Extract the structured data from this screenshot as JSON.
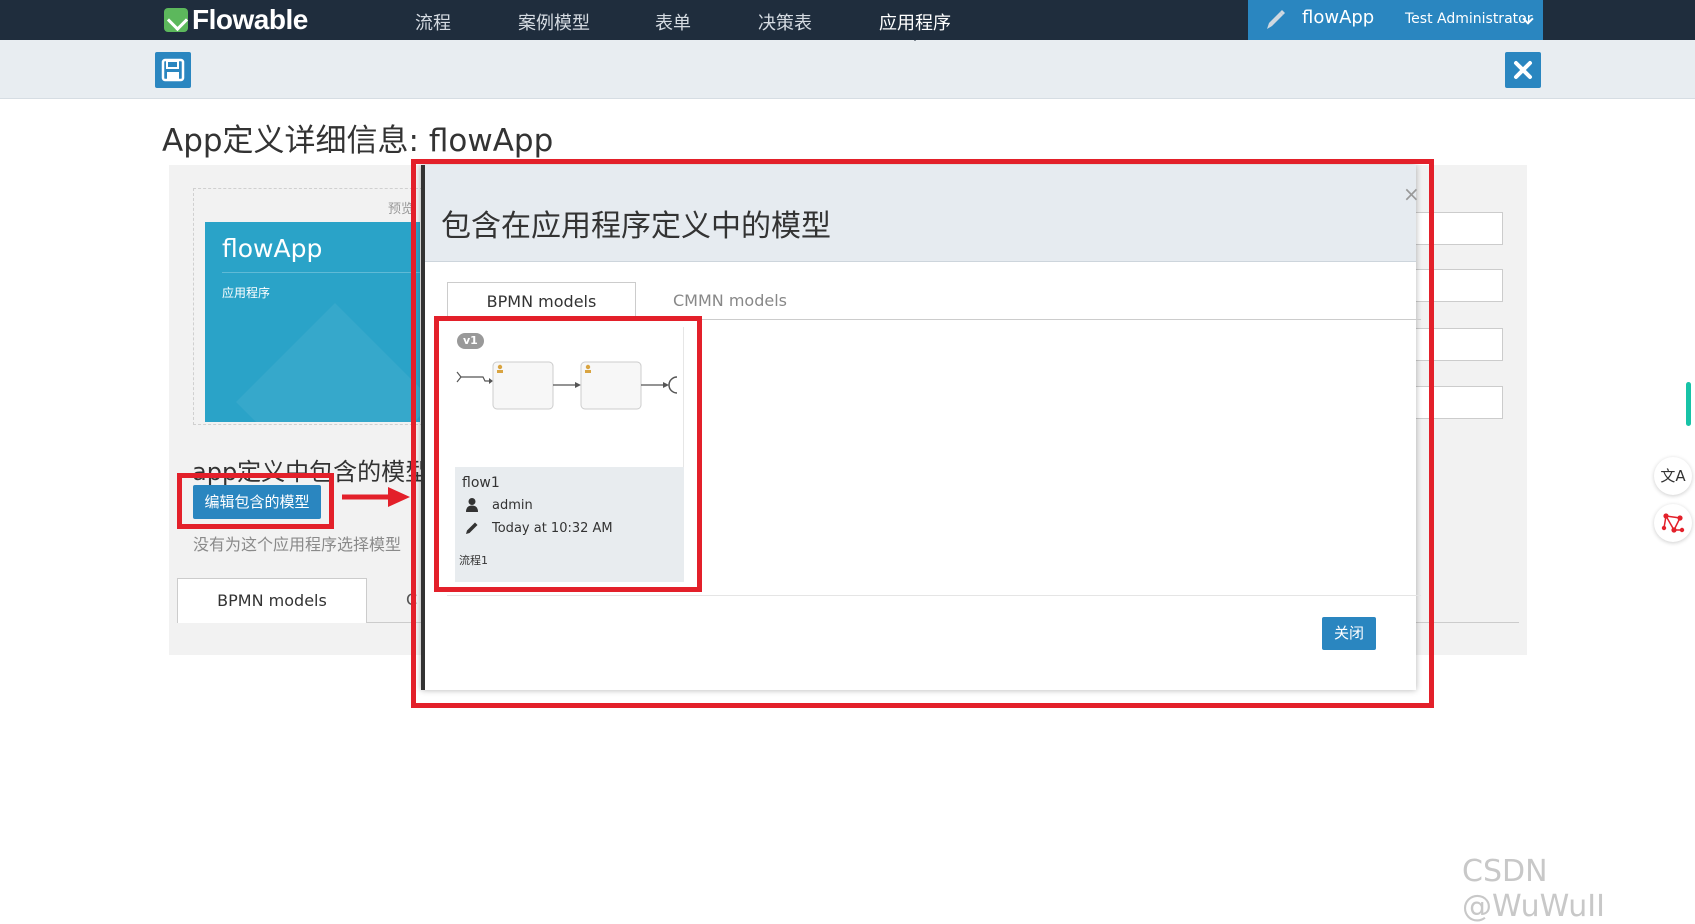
{
  "nav": {
    "brand": "Flowable",
    "items": [
      {
        "label": "流程"
      },
      {
        "label": "案例模型"
      },
      {
        "label": "表单"
      },
      {
        "label": "决策表"
      },
      {
        "label": "应用程序",
        "active": true
      }
    ],
    "app_name": "flowApp",
    "user": "Test Administrator",
    "icons": {
      "edit": "pencil-icon",
      "save": "save-icon",
      "close": "close-icon",
      "user_menu": "chevron-down-icon"
    }
  },
  "page": {
    "title": "App定义详细信息: flowApp"
  },
  "background": {
    "preview_label": "预览",
    "tile_name": "flowApp",
    "tile_type": "应用程序",
    "included_title": "app定义中包含的模型",
    "edit_button": "编辑包含的模型",
    "no_models_text": "没有为这个应用程序选择模型",
    "tab_bpmn": "BPMN models",
    "tab_cmmn_partial": "C"
  },
  "modal": {
    "title": "包含在应用程序定义中的模型",
    "close_symbol": "×",
    "tabs": [
      {
        "label": "BPMN models",
        "active": true
      },
      {
        "label": "CMMN models",
        "active": false
      }
    ],
    "card": {
      "version": "v1",
      "name": "flow1",
      "user": "admin",
      "date": "Today at 10:32 AM",
      "description": "流程1"
    },
    "close_button": "关闭"
  },
  "side": {
    "translate_glyph": "文A"
  },
  "watermark": "CSDN @WuWuII",
  "colors": {
    "nav_bg": "#1f2d3d",
    "accent": "#2a86c0",
    "annotation": "#e3202a",
    "tile": "#2aa3c8"
  }
}
